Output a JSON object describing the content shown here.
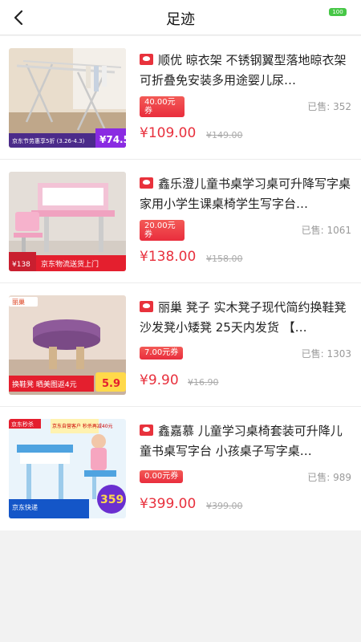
{
  "header": {
    "title": "足迹",
    "battery_level": "100"
  },
  "products": [
    {
      "title": "顺优 晾衣架 不锈钢翼型落地晾衣架 可折叠免安装多用途婴儿尿…",
      "coupon": "40.00元\n券",
      "sold": "已售:  352",
      "price": "¥109.00",
      "old_price": "¥149.00",
      "thumb": {
        "label": "京东节劳惠享5折 (3.26-4.3)",
        "badge": "¥74.5"
      }
    },
    {
      "title": "鑫乐澄儿童书桌学习桌可升降写字桌家用小学生课桌椅学生写字台…",
      "coupon": "20.00元\n券",
      "sold": "已售:  1061",
      "price": "¥138.00",
      "old_price": "¥158.00",
      "thumb": {
        "label": "京东物流送货上门",
        "badge": "¥138"
      }
    },
    {
      "title": "丽巢 凳子 实木凳子现代简约换鞋凳沙发凳小矮凳 25天内发货 【…",
      "coupon": "7.00元券",
      "sold": "已售:  1303",
      "price": "¥9.90",
      "old_price": "¥16.90",
      "thumb": {
        "brand": "丽巢",
        "label": "换鞋凳 晒美图返4元",
        "badge": "5.9"
      }
    },
    {
      "title": "鑫嘉慕 儿童学习桌椅套装可升降儿童书桌写字台 小孩桌子写字桌…",
      "coupon": "0.00元券",
      "sold": "已售:  989",
      "price": "¥399.00",
      "old_price": "¥399.00",
      "thumb": {
        "brand": "京东秒杀",
        "promo": "京东自营客户 秒杀再减40元",
        "label": "京东快递",
        "badge": "359"
      }
    }
  ]
}
